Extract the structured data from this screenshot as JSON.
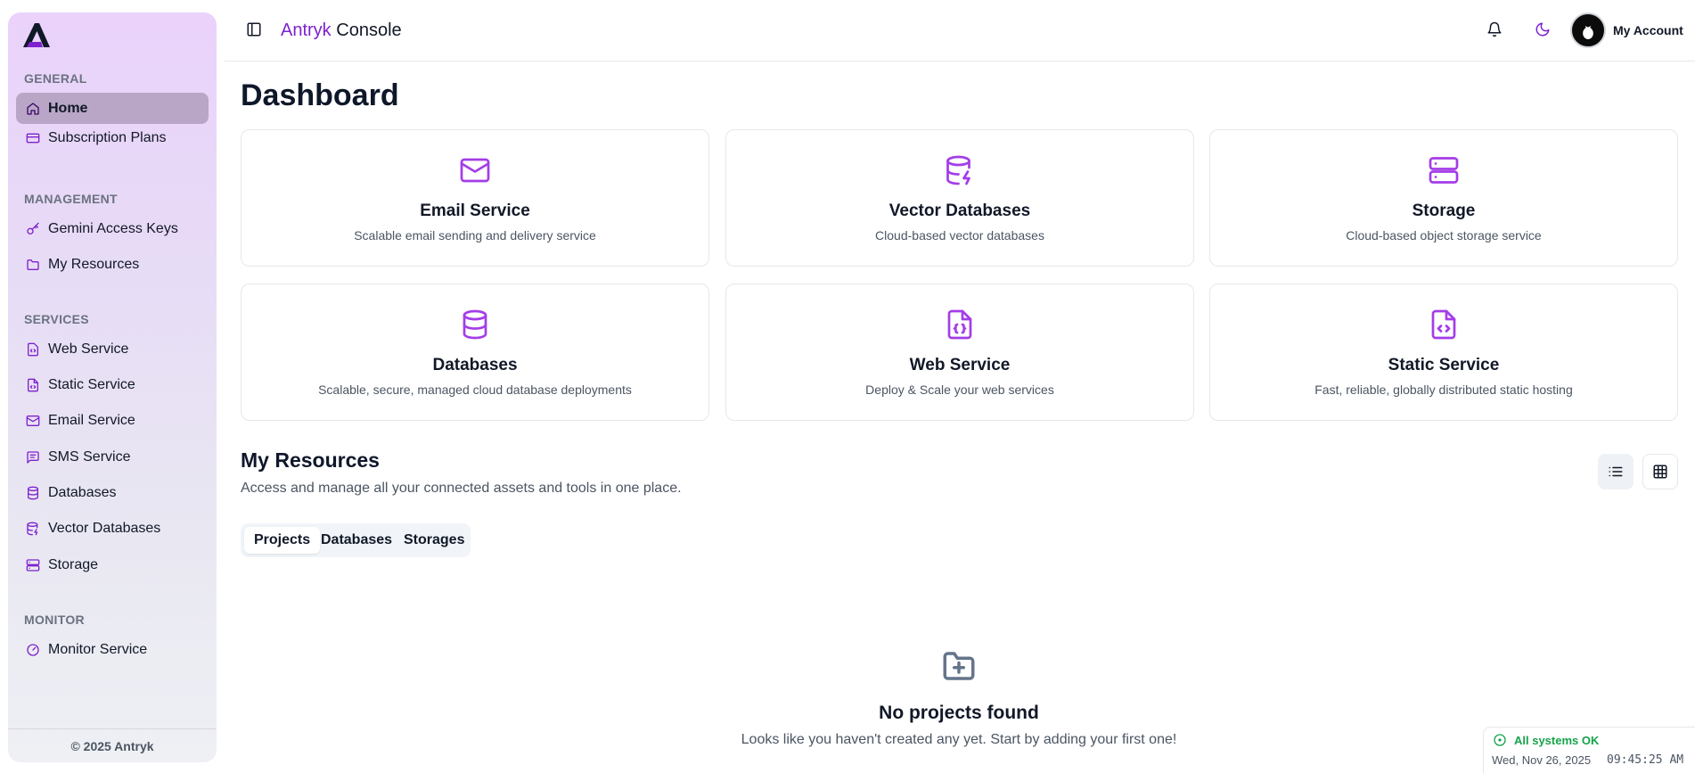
{
  "header": {
    "brand_accent": "Antryk",
    "brand_rest": "Console",
    "account_label": "My Account"
  },
  "sidebar": {
    "sections": {
      "general": "GENERAL",
      "management": "MANAGEMENT",
      "services": "SERVICES",
      "monitor": "MONITOR"
    },
    "items": [
      {
        "label": "Home",
        "icon": "home-icon",
        "active": true
      },
      {
        "label": "Subscription Plans",
        "icon": "credit-card-icon"
      },
      {
        "label": "Gemini Access Keys",
        "icon": "key-icon"
      },
      {
        "label": "My Resources",
        "icon": "folder-icon"
      },
      {
        "label": "Web Service",
        "icon": "file-code-icon"
      },
      {
        "label": "Static Service",
        "icon": "file-code-icon"
      },
      {
        "label": "Email Service",
        "icon": "mail-icon"
      },
      {
        "label": "SMS Service",
        "icon": "message-square-icon"
      },
      {
        "label": "Databases",
        "icon": "database-icon"
      },
      {
        "label": "Vector Databases",
        "icon": "database-zap-icon"
      },
      {
        "label": "Storage",
        "icon": "server-icon"
      },
      {
        "label": "Monitor Service",
        "icon": "gauge-icon"
      }
    ],
    "footer": "© 2025 Antryk"
  },
  "main": {
    "title": "Dashboard",
    "cards": [
      {
        "title": "Email Service",
        "desc": "Scalable email sending and delivery service",
        "icon": "mail-icon"
      },
      {
        "title": "Vector Databases",
        "desc": "Cloud-based vector databases",
        "icon": "database-zap-icon"
      },
      {
        "title": "Storage",
        "desc": "Cloud-based object storage service",
        "icon": "server-icon"
      },
      {
        "title": "Databases",
        "desc": "Scalable, secure, managed cloud database deployments",
        "icon": "database-icon"
      },
      {
        "title": "Web Service",
        "desc": "Deploy & Scale your web services",
        "icon": "file-braces-icon"
      },
      {
        "title": "Static Service",
        "desc": "Fast, reliable, globally distributed static hosting",
        "icon": "file-code-icon"
      }
    ],
    "resources": {
      "title": "My Resources",
      "subtitle": "Access and manage all your connected assets and tools in one place.",
      "tabs": [
        "Projects",
        "Databases",
        "Storages"
      ],
      "active_tab": "Projects",
      "empty_title": "No projects found",
      "empty_subtitle": "Looks like you haven't created any yet. Start by adding your first one!"
    }
  },
  "status": {
    "text": "All systems OK",
    "date": "Wed, Nov 26, 2025",
    "time": "09:45:25 AM"
  },
  "colors": {
    "accent": "#7e22ce",
    "card_icon": "#a43de8",
    "status_ok": "#16a34a"
  }
}
